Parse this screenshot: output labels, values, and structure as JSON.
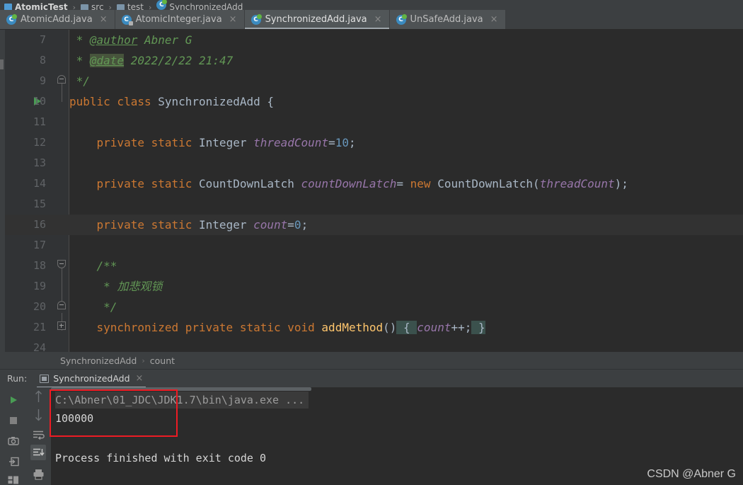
{
  "window": {
    "theme_bg": "#3C3F41",
    "editor_bg": "#2B2B2B",
    "accent": "#4E9AD4"
  },
  "navbar": {
    "project": "AtomicTest",
    "sep": "›",
    "src": "src",
    "test": "test",
    "file": "SynchronizedAdd"
  },
  "tabs": [
    {
      "label": "AtomicAdd.java",
      "icon": "java-class-icon",
      "close": "×",
      "active": false
    },
    {
      "label": "AtomicInteger.java",
      "icon": "java-class-locked-icon",
      "close": "×",
      "active": false
    },
    {
      "label": "SynchronizedAdd.java",
      "icon": "java-class-icon",
      "close": "×",
      "active": true
    },
    {
      "label": "UnSafeAdd.java",
      "icon": "java-class-icon",
      "close": "×",
      "active": false
    }
  ],
  "editor": {
    "caret_line_number": 16,
    "run_marker_line": 10,
    "line_numbers": [
      7,
      8,
      9,
      10,
      11,
      12,
      13,
      14,
      15,
      16,
      17,
      18,
      19,
      20,
      21,
      24
    ],
    "lines": [
      {
        "n": 7,
        "text": " * @author Abner G"
      },
      {
        "n": 8,
        "text": " * @date 2022/2/22 21:47"
      },
      {
        "n": 9,
        "text": " */"
      },
      {
        "n": 10,
        "text": "public class SynchronizedAdd {"
      },
      {
        "n": 11,
        "text": ""
      },
      {
        "n": 12,
        "text": "    private static Integer threadCount=10;"
      },
      {
        "n": 13,
        "text": ""
      },
      {
        "n": 14,
        "text": "    private static CountDownLatch countDownLatch= new CountDownLatch(threadCount);"
      },
      {
        "n": 15,
        "text": ""
      },
      {
        "n": 16,
        "text": "    private static Integer count=0;"
      },
      {
        "n": 17,
        "text": ""
      },
      {
        "n": 18,
        "text": "    /**"
      },
      {
        "n": 19,
        "text": "     * 加悲观锁"
      },
      {
        "n": 20,
        "text": "     */"
      },
      {
        "n": 21,
        "text": "    synchronized private static void addMethod() { count++; }"
      },
      {
        "n": 24,
        "text": ""
      }
    ],
    "tokens": {
      "author_tag": "@author",
      "author_name": "Abner G",
      "date_tag": "@date",
      "date_value": "2022/2/22 21:47",
      "comment_close": "*/",
      "comment_open": "/**",
      "comment_chinese": "加悲观锁",
      "class_name": "SynchronizedAdd",
      "field_thread_count": "threadCount",
      "field_latch": "countDownLatch",
      "field_count": "count",
      "type_integer": "Integer",
      "type_latch": "CountDownLatch",
      "method_name": "addMethod",
      "num_ten": "10",
      "num_zero": "0"
    }
  },
  "breadcrumb": {
    "class": "SynchronizedAdd",
    "sep": "›",
    "member": "count"
  },
  "run_panel": {
    "run_label": "Run:",
    "tab_label": "SynchronizedAdd",
    "tab_close": "×",
    "tab_icon": "console-icon",
    "toolbar_left": [
      {
        "name": "rerun-button",
        "icon": "play-icon"
      },
      {
        "name": "stop-button",
        "icon": "stop-icon"
      },
      {
        "name": "snapshot-button",
        "icon": "camera-icon"
      },
      {
        "name": "dump-button",
        "icon": "export-icon"
      },
      {
        "name": "layout-button",
        "icon": "layout-icon"
      }
    ],
    "toolbar_right": [
      {
        "name": "up-button",
        "icon": "arrow-up-icon"
      },
      {
        "name": "down-button",
        "icon": "arrow-down-icon"
      },
      {
        "name": "soft-wrap-button",
        "icon": "soft-wrap-icon"
      },
      {
        "name": "scroll-to-end-button",
        "icon": "scroll-end-icon",
        "selected": true
      },
      {
        "name": "print-button",
        "icon": "print-icon"
      }
    ],
    "console": [
      {
        "type": "command",
        "text": "C:\\Abner\\01_JDC\\JDK1.7\\bin\\java.exe ..."
      },
      {
        "type": "output",
        "text": "100000"
      },
      {
        "type": "output",
        "text": "Process finished with exit code 0"
      }
    ]
  },
  "annotation": {
    "highlight_color": "#ED1C24"
  },
  "watermark": {
    "text": "CSDN @Abner G"
  }
}
